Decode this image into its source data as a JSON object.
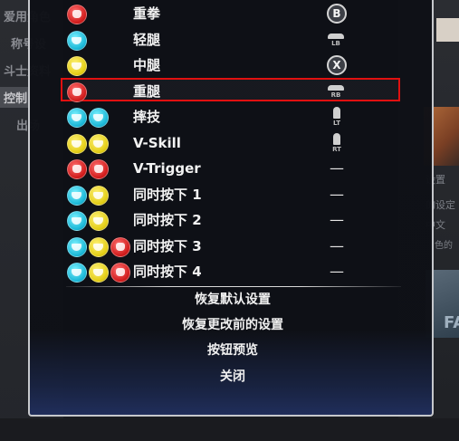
{
  "background": {
    "left_menu": [
      "爱用角色",
      "称号设",
      "斗士资料",
      "控制",
      "出场"
    ],
    "right_text": [
      "设置",
      "中文",
      "的设定",
      "色的"
    ],
    "art_text": "FA"
  },
  "colors": {
    "highlight": "#e01010",
    "punch": "#d01a1a",
    "kick_light": "#18b6d6",
    "kick_medium": "#e2cc12"
  },
  "rows": [
    {
      "label": "重拳",
      "icons": [
        "red"
      ],
      "assign_type": "circle",
      "assign": "B"
    },
    {
      "label": "轻腿",
      "icons": [
        "blue"
      ],
      "assign_type": "bumper",
      "assign": "LB"
    },
    {
      "label": "中腿",
      "icons": [
        "yellow"
      ],
      "assign_type": "circle",
      "assign": "X"
    },
    {
      "label": "重腿",
      "icons": [
        "red"
      ],
      "assign_type": "bumper",
      "assign": "RB",
      "selected": true
    },
    {
      "label": "摔技",
      "icons": [
        "blue",
        "blue"
      ],
      "assign_type": "trigger",
      "assign": "LT"
    },
    {
      "label": "V-Skill",
      "icons": [
        "yellow",
        "yellow"
      ],
      "assign_type": "trigger",
      "assign": "RT"
    },
    {
      "label": "V-Trigger",
      "icons": [
        "red",
        "red"
      ],
      "assign_type": "dash",
      "assign": "—"
    },
    {
      "label": "同时按下 1",
      "icons": [
        "blue",
        "yellow"
      ],
      "assign_type": "dash",
      "assign": "—"
    },
    {
      "label": "同时按下 2",
      "icons": [
        "blue",
        "yellow"
      ],
      "assign_type": "dash",
      "assign": "—"
    },
    {
      "label": "同时按下 3",
      "icons": [
        "blue",
        "yellow",
        "red"
      ],
      "assign_type": "dash",
      "assign": "—"
    },
    {
      "label": "同时按下 4",
      "icons": [
        "blue",
        "yellow",
        "red"
      ],
      "assign_type": "dash",
      "assign": "—"
    }
  ],
  "menu": {
    "restore_default": "恢复默认设置",
    "restore_previous": "恢复更改前的设置",
    "button_preview": "按钮预览",
    "close": "关闭"
  }
}
